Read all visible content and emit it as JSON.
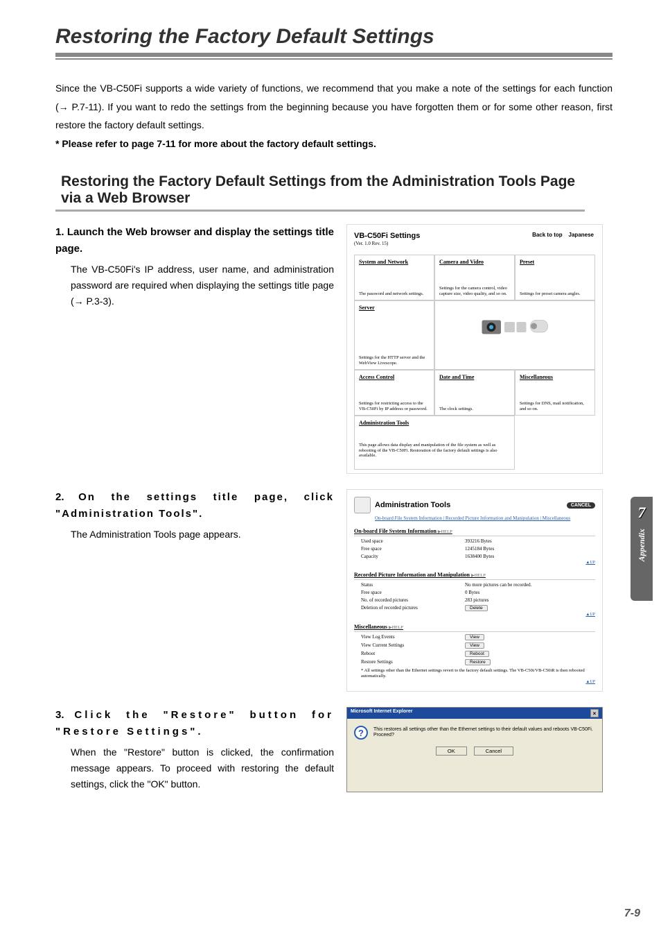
{
  "page": {
    "title": "Restoring the Factory Default Settings",
    "intro": "Since the VB-C50Fi supports a wide variety of functions, we recommend that you make a note of the settings for each function (→ P.7-11). If you want to redo the settings from the beginning because you have forgotten them or for some other reason, first restore the factory default settings.",
    "intro_note": "* Please refer to page 7-11 for more about the factory default settings.",
    "subhead": "Restoring the Factory Default Settings from the Administration Tools Page via a Web Browser",
    "side_tab_number": "7",
    "side_tab_label": "Appendix",
    "page_number": "7-9"
  },
  "steps": [
    {
      "num": "1.",
      "title": "Launch the Web browser and display the settings title page.",
      "body": "The VB-C50Fi's IP address, user name, and administration password are required when displaying the settings title page (→ P.3-3)."
    },
    {
      "num": "2.",
      "title": "On the settings title page, click \"Administration Tools\".",
      "body": "The Administration Tools page appears."
    },
    {
      "num": "3.",
      "title": "Click the \"Restore\" button for \"Restore Settings\".",
      "body": "When the \"Restore\" button is clicked, the confirmation message appears. To proceed with restoring the default settings, click the \"OK\" button."
    }
  ],
  "shot1": {
    "title": "VB-C50Fi Settings",
    "version": "(Ver. 1.0 Rev. 15)",
    "link_back": "Back to top",
    "link_jp": "Japanese",
    "cells": {
      "system_network": {
        "title": "System and Network",
        "desc": "The password and network settings."
      },
      "camera_video": {
        "title": "Camera and Video",
        "desc": "Settings for the camera control, video capture size, video quality, and so on."
      },
      "preset": {
        "title": "Preset",
        "desc": "Settings for preset camera angles."
      },
      "server": {
        "title": "Server",
        "desc": "Settings for the HTTP server and the WebView Livescope."
      },
      "access": {
        "title": "Access Control",
        "desc": "Settings for restricting access to the VB-C50Fi by IP address or password."
      },
      "date_time": {
        "title": "Date and Time",
        "desc": "The clock settings."
      },
      "misc": {
        "title": "Miscellaneous",
        "desc": "Settings for DNS, mail notification, and so on."
      },
      "admin": {
        "title": "Administration Tools",
        "desc": "This page allows data display and manipulation of the file system as well as rebooting of the VB-C50Fi. Restoration of the factory default settings is also available."
      }
    }
  },
  "shot2": {
    "title": "Administration Tools",
    "cancel": "CANCEL",
    "links": "On-board File System Information | Recorded Picture Information and Manipulation | Miscellaneous",
    "section1_title": "On-board File System Information",
    "help": "▶HELP",
    "up": "▲UP",
    "rows1": [
      {
        "key": "Used space",
        "value": "393216 Bytes"
      },
      {
        "key": "Free space",
        "value": "1245184 Bytes"
      },
      {
        "key": "Capacity",
        "value": "1638400 Bytes"
      }
    ],
    "section2_title": "Recorded Picture Information and Manipulation",
    "rows2": [
      {
        "key": "Status",
        "value": "No more pictures can be recorded."
      },
      {
        "key": "Free space",
        "value": "0 Bytes"
      },
      {
        "key": "No. of recorded pictures",
        "value": "283 pictures"
      },
      {
        "key": "Deletion of recorded pictures",
        "button": "Delete"
      }
    ],
    "section3_title": "Miscellaneous",
    "rows3": [
      {
        "key": "View Log Events",
        "button": "View"
      },
      {
        "key": "View Current Settings",
        "button": "View"
      },
      {
        "key": "Reboot",
        "button": "Reboot"
      },
      {
        "key": "Restore Settings",
        "button": "Restore"
      }
    ],
    "note": "* All settings other than the Ethernet settings revert to the factory default settings. The VB-C50i/VB-C50iR is then rebooted automatically."
  },
  "shot3": {
    "title": "Microsoft Internet Explorer",
    "message": "This restores all settings other than the Ethernet settings to their default values and reboots VB-C50Fi. Proceed?",
    "ok": "OK",
    "cancel": "Cancel"
  }
}
